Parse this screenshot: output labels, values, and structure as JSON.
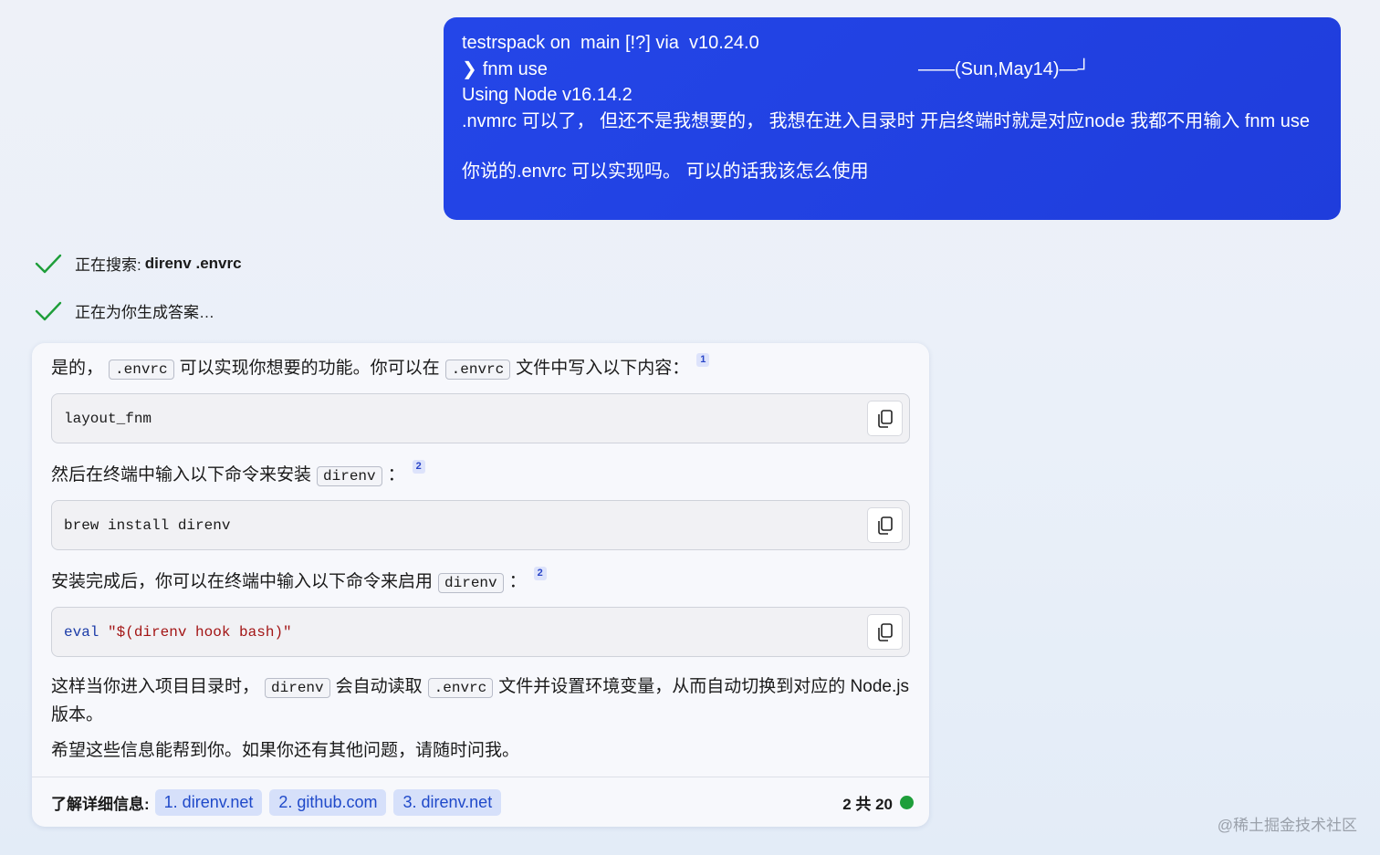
{
  "user_message": {
    "line1": "testrspack on  main [!?] via  v10.24.0",
    "chevron": "❯",
    "line2": "fnm use",
    "line2_right": "——(Sun,May14)—┘",
    "line3": "Using Node v16.14.2",
    "line4": ".nvmrc 可以了， 但还不是我想要的， 我想在进入目录时 开启终端时就是对应node 我都不用输入 fnm use",
    "line5": "你说的.envrc 可以实现吗。 可以的话我该怎么使用"
  },
  "status": {
    "search_prefix": "正在搜索:",
    "search_query": "direnv .envrc",
    "generating": "正在为你生成答案…"
  },
  "answer": {
    "p1_a": "是的，",
    "p1_code1": ".envrc",
    "p1_b": "可以实现你想要的功能。你可以在",
    "p1_code2": ".envrc",
    "p1_c": "文件中写入以下内容：",
    "p1_cite": "1",
    "code1": "layout_fnm",
    "p2_a": "然后在终端中输入以下命令来安装",
    "p2_code": "direnv",
    "p2_b": "：",
    "p2_cite": "2",
    "code2": "brew install direnv",
    "p3_a": "安装完成后，你可以在终端中输入以下命令来启用",
    "p3_code": "direnv",
    "p3_b": "：",
    "p3_cite": "2",
    "code3_kw": "eval",
    "code3_str": "\"$(direnv hook bash)\"",
    "p4_a": "这样当你进入项目目录时，",
    "p4_code1": "direnv",
    "p4_b": "会自动读取",
    "p4_code2": ".envrc",
    "p4_c": "文件并设置环境变量，从而自动切换到对应的 Node.js 版本。",
    "p5": "希望这些信息能帮到你。如果你还有其他问题，请随时问我。"
  },
  "footer": {
    "label": "了解详细信息:",
    "sources": [
      "1. direnv.net",
      "2. github.com",
      "3. direnv.net"
    ],
    "count": "2 共 20",
    "status_color": "#1e9e3a"
  },
  "watermark": "@稀土掘金技术社区"
}
